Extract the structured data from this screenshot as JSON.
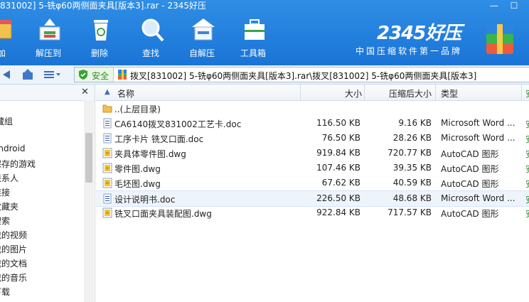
{
  "window": {
    "title": "831002] 5-铣φ60两侧面夹具[版本3].rar - 2345好压"
  },
  "toolbar": [
    {
      "label": "加",
      "icon": "add-icon"
    },
    {
      "label": "解压到",
      "icon": "extract-to-icon"
    },
    {
      "label": "删除",
      "icon": "trash-icon"
    },
    {
      "label": "查找",
      "icon": "search-icon"
    },
    {
      "label": "自解压",
      "icon": "self-extract-icon"
    },
    {
      "label": "工具箱",
      "icon": "toolbox-icon"
    }
  ],
  "brand": {
    "name": "2345好压",
    "slogan": "中国压缩软件第一品牌"
  },
  "address": {
    "safe_label": "安全",
    "path": "拨叉[831002] 5-铣φ60两侧面夹具[版本3].rar\\拨叉[831002] 5-铣φ60两侧面夹具[版本3]"
  },
  "sidebar": {
    "items": [
      "藏组",
      "android",
      "保存的游戏",
      "联系人",
      "链接",
      "收藏夹",
      "搜索",
      "我的视频",
      "我的图片",
      "我的文档",
      "我的音乐",
      "下载"
    ]
  },
  "columns": {
    "name": "名称",
    "size": "大小",
    "packed": "压缩后大小",
    "type": "类型",
    "extra": "安"
  },
  "files": [
    {
      "name": "..(上层目录)",
      "size": "",
      "packed": "",
      "type": "",
      "extra": "",
      "icon": "folder-icon"
    },
    {
      "name": "CA6140拨叉831002工艺卡.doc",
      "size": "116.50 KB",
      "packed": "9.16 KB",
      "type": "Microsoft Word ...",
      "extra": "安",
      "icon": "doc-icon"
    },
    {
      "name": "工序卡片 铣叉口面.doc",
      "size": "76.50 KB",
      "packed": "28.26 KB",
      "type": "Microsoft Word ...",
      "extra": "安",
      "icon": "doc-icon"
    },
    {
      "name": "夹具体零件图.dwg",
      "size": "919.84 KB",
      "packed": "720.77 KB",
      "type": "AutoCAD 图形",
      "extra": "安",
      "icon": "dwg-icon"
    },
    {
      "name": "零件图.dwg",
      "size": "107.46 KB",
      "packed": "39.35 KB",
      "type": "AutoCAD 图形",
      "extra": "安",
      "icon": "dwg-icon"
    },
    {
      "name": "毛坯图.dwg",
      "size": "67.62 KB",
      "packed": "40.59 KB",
      "type": "AutoCAD 图形",
      "extra": "安",
      "icon": "dwg-icon"
    },
    {
      "name": "设计说明书.doc",
      "size": "226.50 KB",
      "packed": "48.68 KB",
      "type": "Microsoft Word ...",
      "extra": "安",
      "icon": "doc-icon"
    },
    {
      "name": "铣叉口面夹具装配图.dwg",
      "size": "922.84 KB",
      "packed": "717.57 KB",
      "type": "AutoCAD 图形",
      "extra": "安",
      "icon": "dwg-icon"
    }
  ],
  "colors": {
    "accent": "#1a74d6",
    "safe": "#2f8a2a"
  }
}
